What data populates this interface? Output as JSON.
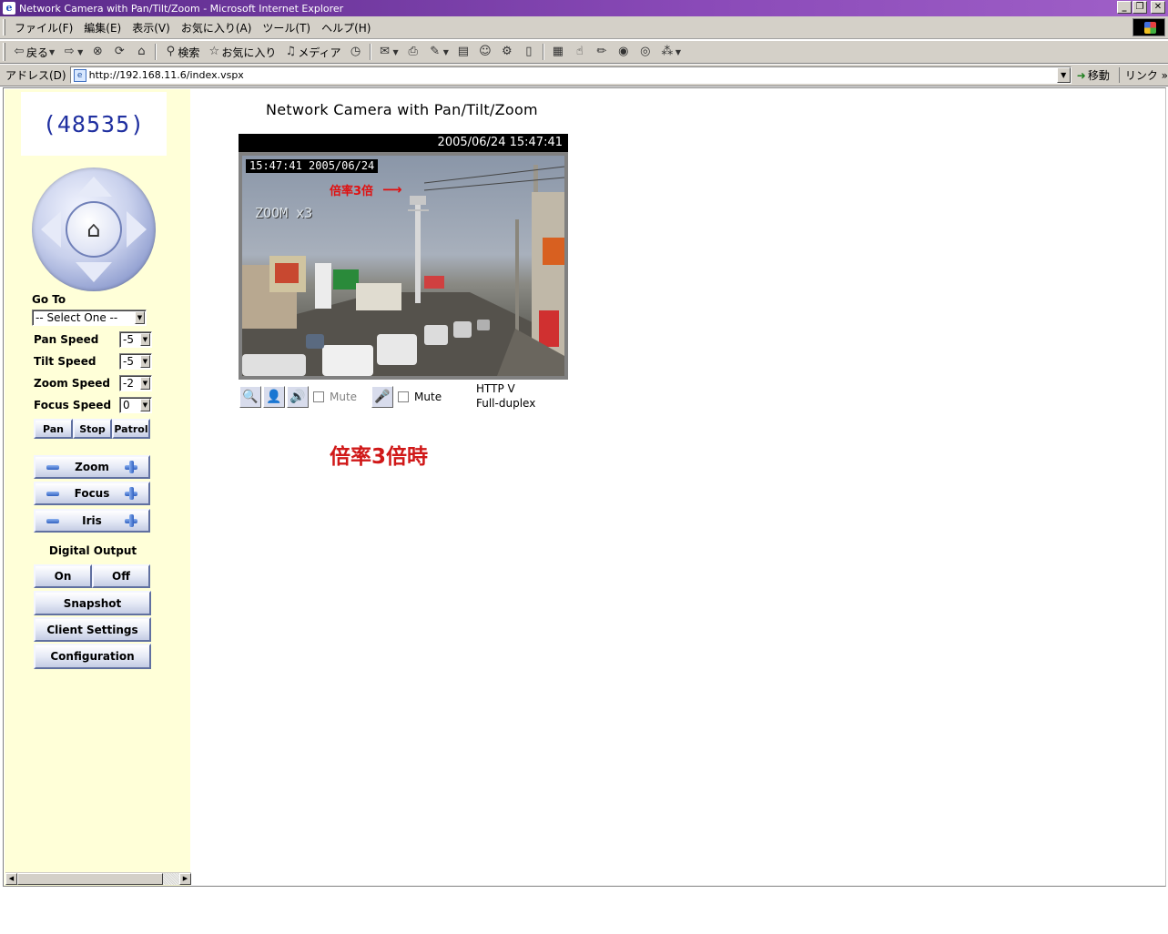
{
  "window": {
    "title": "Network Camera with Pan/Tilt/Zoom - Microsoft Internet Explorer",
    "app_icon": "ie-icon",
    "buttons": [
      "minimize",
      "restore",
      "close"
    ]
  },
  "menu": {
    "items": [
      "ファイル(F)",
      "編集(E)",
      "表示(V)",
      "お気に入り(A)",
      "ツール(T)",
      "ヘルプ(H)"
    ]
  },
  "toolbar": {
    "back": "戻る",
    "search": "検索",
    "favorites": "お気に入り",
    "media": "メディア"
  },
  "address": {
    "label": "アドレス(D)",
    "url": "http://192.168.11.6/index.vspx",
    "go": "移動",
    "links": "リンク"
  },
  "panel": {
    "counter": "(48535)",
    "goto_label": "Go To",
    "goto_select": "-- Select One --",
    "speeds": [
      {
        "label": "Pan Speed",
        "value": "-5"
      },
      {
        "label": "Tilt Speed",
        "value": "-5"
      },
      {
        "label": "Zoom Speed",
        "value": "-2"
      },
      {
        "label": "Focus Speed",
        "value": "0"
      }
    ],
    "pan_btn": "Pan",
    "stop_btn": "Stop",
    "patrol_btn": "Patrol",
    "zoom_label": "Zoom",
    "focus_label": "Focus",
    "iris_label": "Iris",
    "digital_output_label": "Digital Output",
    "on_btn": "On",
    "off_btn": "Off",
    "snapshot_btn": "Snapshot",
    "client_settings_btn": "Client Settings",
    "configuration_btn": "Configuration"
  },
  "main": {
    "title": "Network Camera with Pan/Tilt/Zoom",
    "header_timestamp": "2005/06/24 15:47:41",
    "osd_timestamp": "15:47:41  2005/06/24",
    "osd_zoom": "ZOOM x3",
    "osd_annotation": "倍率3倍",
    "mute1": "Mute",
    "mute2": "Mute",
    "protocol": "HTTP   V",
    "duplex": "Full-duplex",
    "caption": "倍率3倍時"
  },
  "colors": {
    "panel_bg": "#ffffd8",
    "counter_text": "#2030a0",
    "caption_red": "#d01818",
    "titlebar": "#6a3296"
  }
}
